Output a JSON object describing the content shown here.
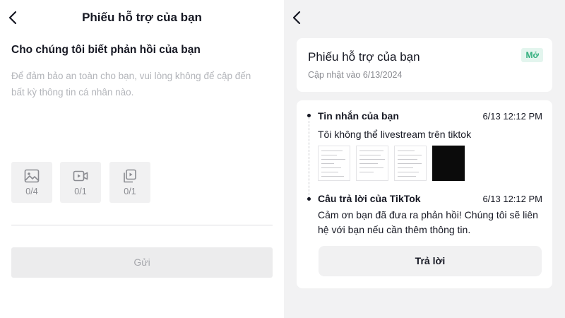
{
  "left_panel": {
    "title": "Phiếu hỗ trợ của bạn",
    "prompt": "Cho chúng tôi biết phản hồi của bạn",
    "placeholder": "Để đảm bảo an toàn cho bạn, vui lòng không để cập đến bất kỳ thông tin cá nhân nào.",
    "attachments": [
      {
        "icon": "image-icon",
        "count": "0/4"
      },
      {
        "icon": "video-icon",
        "count": "0/1"
      },
      {
        "icon": "file-icon",
        "count": "0/1"
      }
    ],
    "send_label": "Gửi"
  },
  "right_panel": {
    "ticket": {
      "title": "Phiếu hỗ trợ của bạn",
      "updated": "Cập nhật vào 6/13/2024",
      "status": "Mở"
    },
    "messages": [
      {
        "sender": "Tin nhắn của bạn",
        "time": "6/13 12:12 PM",
        "text": "Tôi không thể livestream trên tiktok"
      },
      {
        "sender": "Câu trả lời của TikTok",
        "time": "6/13 12:12 PM",
        "text": "Cảm ơn bạn đã đưa ra phản hồi! Chúng tôi sẽ liên hệ với bạn nếu cần thêm thông tin."
      }
    ],
    "reply_label": "Trả lời"
  },
  "colors": {
    "status_green": "#2fae7c",
    "status_bg": "#e3f5ee",
    "panel_gray": "#f2f2f3"
  }
}
